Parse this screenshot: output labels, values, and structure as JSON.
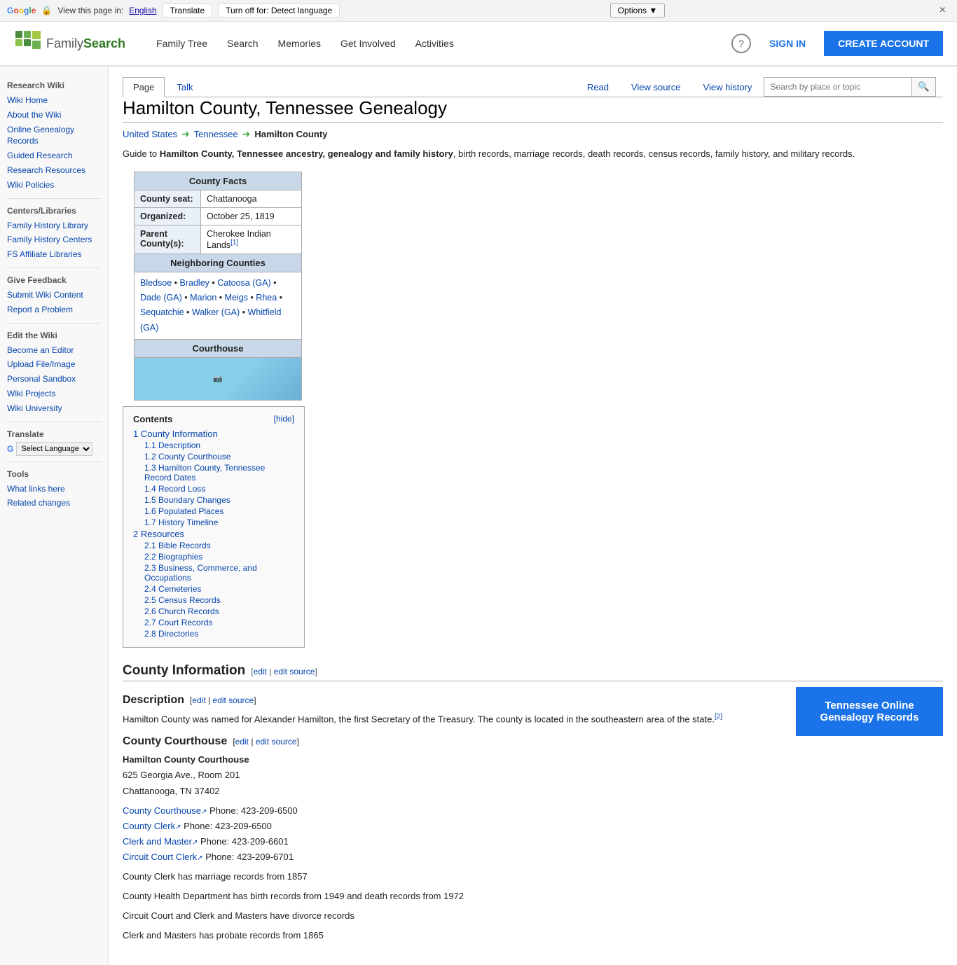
{
  "translate_bar": {
    "prefix": "View this page in:",
    "language": "English",
    "translate_btn": "Translate",
    "turnoff_label": "Turn off for: Detect language",
    "options_label": "Options ▼",
    "close_label": "×"
  },
  "nav": {
    "logo_family": "Family",
    "logo_search": "Search",
    "links": [
      "Family Tree",
      "Search",
      "Memories",
      "Get Involved",
      "Activities"
    ],
    "sign_in": "SIGN IN",
    "create_account": "CREATE ACCOUNT"
  },
  "sidebar": {
    "research_wiki_title": "Research Wiki",
    "items_research": [
      {
        "label": "Wiki Home",
        "href": "#"
      },
      {
        "label": "About the Wiki",
        "href": "#"
      },
      {
        "label": "Online Genealogy Records",
        "href": "#"
      },
      {
        "label": "Guided Research",
        "href": "#"
      },
      {
        "label": "Research Resources",
        "href": "#"
      },
      {
        "label": "Wiki Policies",
        "href": "#"
      }
    ],
    "centers_title": "Centers/Libraries",
    "items_centers": [
      {
        "label": "Family History Library",
        "href": "#"
      },
      {
        "label": "Family History Centers",
        "href": "#"
      },
      {
        "label": "FS Affiliate Libraries",
        "href": "#"
      }
    ],
    "feedback_title": "Give Feedback",
    "items_feedback": [
      {
        "label": "Submit Wiki Content",
        "href": "#"
      },
      {
        "label": "Report a Problem",
        "href": "#"
      }
    ],
    "edit_title": "Edit the Wiki",
    "items_edit": [
      {
        "label": "Become an Editor",
        "href": "#"
      },
      {
        "label": "Upload File/Image",
        "href": "#"
      },
      {
        "label": "Personal Sandbox",
        "href": "#"
      },
      {
        "label": "Wiki Projects",
        "href": "#"
      },
      {
        "label": "Wiki University",
        "href": "#"
      }
    ],
    "translate_title": "Translate",
    "select_language": "Select Language",
    "tools_title": "Tools",
    "items_tools": [
      {
        "label": "What links here",
        "href": "#"
      },
      {
        "label": "Related changes",
        "href": "#"
      }
    ]
  },
  "wiki_tabs": {
    "left": [
      {
        "label": "Page",
        "active": true
      },
      {
        "label": "Talk",
        "active": false
      }
    ],
    "right": [
      {
        "label": "Read"
      },
      {
        "label": "View source"
      },
      {
        "label": "View history"
      }
    ],
    "search_placeholder": "Search by place or topic"
  },
  "article": {
    "title": "Hamilton County, Tennessee Genealogy",
    "breadcrumb": {
      "us": "United States",
      "state": "Tennessee",
      "county": "Hamilton County"
    },
    "intro": "Guide to Hamilton County, Tennessee ancestry, genealogy and family history, birth records, marriage records, death records, census records, family history, and military records.",
    "toc": {
      "title": "Contents",
      "hide": "hide",
      "items": [
        {
          "num": "1",
          "label": "County Information",
          "level": 1
        },
        {
          "num": "1.1",
          "label": "Description",
          "level": 2
        },
        {
          "num": "1.2",
          "label": "County Courthouse",
          "level": 2
        },
        {
          "num": "1.3",
          "label": "Hamilton County, Tennessee Record Dates",
          "level": 2
        },
        {
          "num": "1.4",
          "label": "Record Loss",
          "level": 2
        },
        {
          "num": "1.5",
          "label": "Boundary Changes",
          "level": 2
        },
        {
          "num": "1.6",
          "label": "Populated Places",
          "level": 2
        },
        {
          "num": "1.7",
          "label": "History Timeline",
          "level": 2
        },
        {
          "num": "2",
          "label": "Resources",
          "level": 1
        },
        {
          "num": "2.1",
          "label": "Bible Records",
          "level": 2
        },
        {
          "num": "2.2",
          "label": "Biographies",
          "level": 2
        },
        {
          "num": "2.3",
          "label": "Business, Commerce, and Occupations",
          "level": 2
        },
        {
          "num": "2.4",
          "label": "Cemeteries",
          "level": 2
        },
        {
          "num": "2.5",
          "label": "Census Records",
          "level": 2
        },
        {
          "num": "2.6",
          "label": "Church Records",
          "level": 2
        },
        {
          "num": "2.7",
          "label": "Court Records",
          "level": 2
        },
        {
          "num": "2.8",
          "label": "Directories",
          "level": 2
        }
      ]
    },
    "county_info": {
      "section_title": "County Information",
      "edit": "edit",
      "edit_source": "edit source",
      "tn_button": "Tennessee Online Genealogy Records"
    },
    "description": {
      "section_title": "Description",
      "edit": "edit",
      "edit_source": "edit source",
      "text": "Hamilton County was named for Alexander Hamilton, the first Secretary of the Treasury. The county is located in the southeastern area of the state.",
      "ref": "[2]"
    },
    "courthouse": {
      "section_title": "County Courthouse",
      "edit": "edit",
      "edit_source": "edit source",
      "name": "Hamilton County Courthouse",
      "address1": "625 Georgia Ave., Room 201",
      "address2": "Chattanooga, TN 37402",
      "links": [
        {
          "label": "County Courthouse",
          "phone": "Phone: 423-209-6500"
        },
        {
          "label": "County Clerk",
          "phone": "Phone: 423-209-6500"
        },
        {
          "label": "Clerk and Master",
          "phone": "Phone: 423-209-6601"
        },
        {
          "label": "Circuit Court Clerk",
          "phone": "Phone: 423-209-6701"
        }
      ],
      "records": [
        "County Clerk has marriage records from 1857",
        "County Health Department has birth records from 1949 and death records from 1972",
        "Circuit Court and Clerk and Masters have divorce records",
        "Clerk and Masters has probate records from 1865"
      ]
    },
    "county_facts": {
      "title": "County Facts",
      "seat_label": "County seat:",
      "seat_value": "Chattanooga",
      "organized_label": "Organized:",
      "organized_value": "October 25, 1819",
      "parent_label": "Parent County(s):",
      "parent_value": "Cherokee Indian Lands",
      "parent_ref": "[1]",
      "neighboring_title": "Neighboring Counties",
      "neighbors": [
        "Bledsoe",
        "Bradley",
        "Catoosa (GA)",
        "Dade (GA)",
        "Marion",
        "Meigs",
        "Rhea",
        "Sequatchie",
        "Walker (GA)",
        "Whitfield (GA)"
      ],
      "courthouse_title": "Courthouse",
      "courthouse_img_alt": "Courthouse image"
    }
  }
}
